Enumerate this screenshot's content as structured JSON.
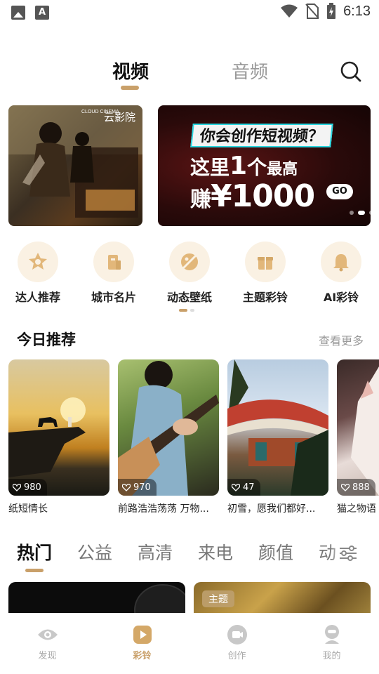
{
  "status_bar": {
    "time": "6:13",
    "icons": [
      "image-icon",
      "font-icon",
      "wifi-icon",
      "no-sim-icon",
      "battery-charging-icon"
    ]
  },
  "top_tabs": {
    "items": [
      {
        "label": "视频",
        "active": true
      },
      {
        "label": "音频",
        "active": false
      }
    ],
    "search_icon": "search-icon"
  },
  "banners": {
    "left": {
      "logo_text": "云影院",
      "logo_small": "CLOUD CINEMA"
    },
    "right": {
      "line1": "你会创作短视频？",
      "line2_a": "这里",
      "line2_b": "1",
      "line2_c": "个",
      "line2_d": "最高",
      "line3_a": "赚",
      "line3_b": "¥1000",
      "go": "GO"
    },
    "dots": 3,
    "active_dot": 1
  },
  "categories": [
    {
      "label": "达人推荐",
      "icon": "star-badge-icon"
    },
    {
      "label": "城市名片",
      "icon": "building-icon"
    },
    {
      "label": "动态壁纸",
      "icon": "wallpaper-icon"
    },
    {
      "label": "主题彩铃",
      "icon": "gift-icon"
    },
    {
      "label": "AI彩铃",
      "icon": "bell-icon"
    }
  ],
  "today": {
    "title": "今日推荐",
    "more": "查看更多",
    "cards": [
      {
        "likes": "980",
        "title": "纸短情长"
      },
      {
        "likes": "970",
        "title": "前路浩浩荡荡 万物..."
      },
      {
        "likes": "47",
        "title": "初雪，愿我们都好..."
      },
      {
        "likes": "888",
        "title": "猫之物语"
      }
    ]
  },
  "category_tabs": {
    "items": [
      "热门",
      "公益",
      "高清",
      "来电",
      "颜值",
      "动"
    ],
    "active_index": 0,
    "filter_icon": "filter-sliders-icon"
  },
  "feed": {
    "right_badge": "主题"
  },
  "bottom_nav": [
    {
      "label": "发现",
      "icon": "eye-icon",
      "active": false
    },
    {
      "label": "彩铃",
      "icon": "play-icon",
      "active": true
    },
    {
      "label": "创作",
      "icon": "video-camera-icon",
      "active": false
    },
    {
      "label": "我的",
      "icon": "profile-icon",
      "active": false
    }
  ],
  "colors": {
    "accent": "#c9a06a",
    "icon_bg": "#faf1e3"
  }
}
